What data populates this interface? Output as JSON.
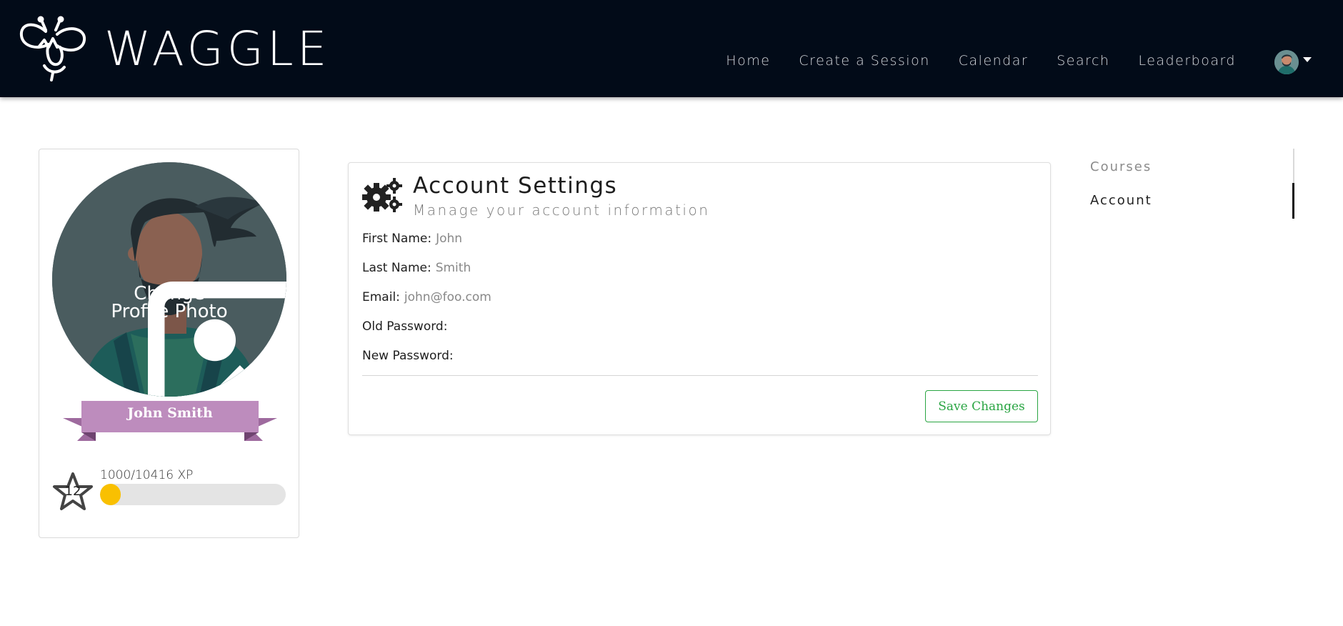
{
  "brand": {
    "name": "WAGGLE"
  },
  "nav": {
    "links": [
      "Home",
      "Create a Session",
      "Calendar",
      "Search",
      "Leaderboard"
    ]
  },
  "profile": {
    "name": "John Smith",
    "change_photo_line1": "Change",
    "change_photo_line2": "Profile Photo",
    "level": "12",
    "xp_text": "1000/10416 XP",
    "xp_fraction": 0.096
  },
  "settings": {
    "title": "Account Settings",
    "subtitle": "Manage your account information",
    "fields": [
      {
        "label": "First Name:",
        "value": "John"
      },
      {
        "label": "Last Name:",
        "value": "Smith"
      },
      {
        "label": "Email:",
        "value": "john@foo.com"
      },
      {
        "label": "Old Password:",
        "value": ""
      },
      {
        "label": "New Password:",
        "value": ""
      }
    ],
    "save_label": "Save Changes"
  },
  "subnav": {
    "items": [
      "Courses",
      "Account"
    ],
    "active": "Account"
  },
  "colors": {
    "navbar_bg": "#020b18",
    "ribbon": "#bd8cbd",
    "ribbon_dark": "#9e6a9e",
    "xp_fill": "#f9c001",
    "save_green": "#2aa543"
  }
}
